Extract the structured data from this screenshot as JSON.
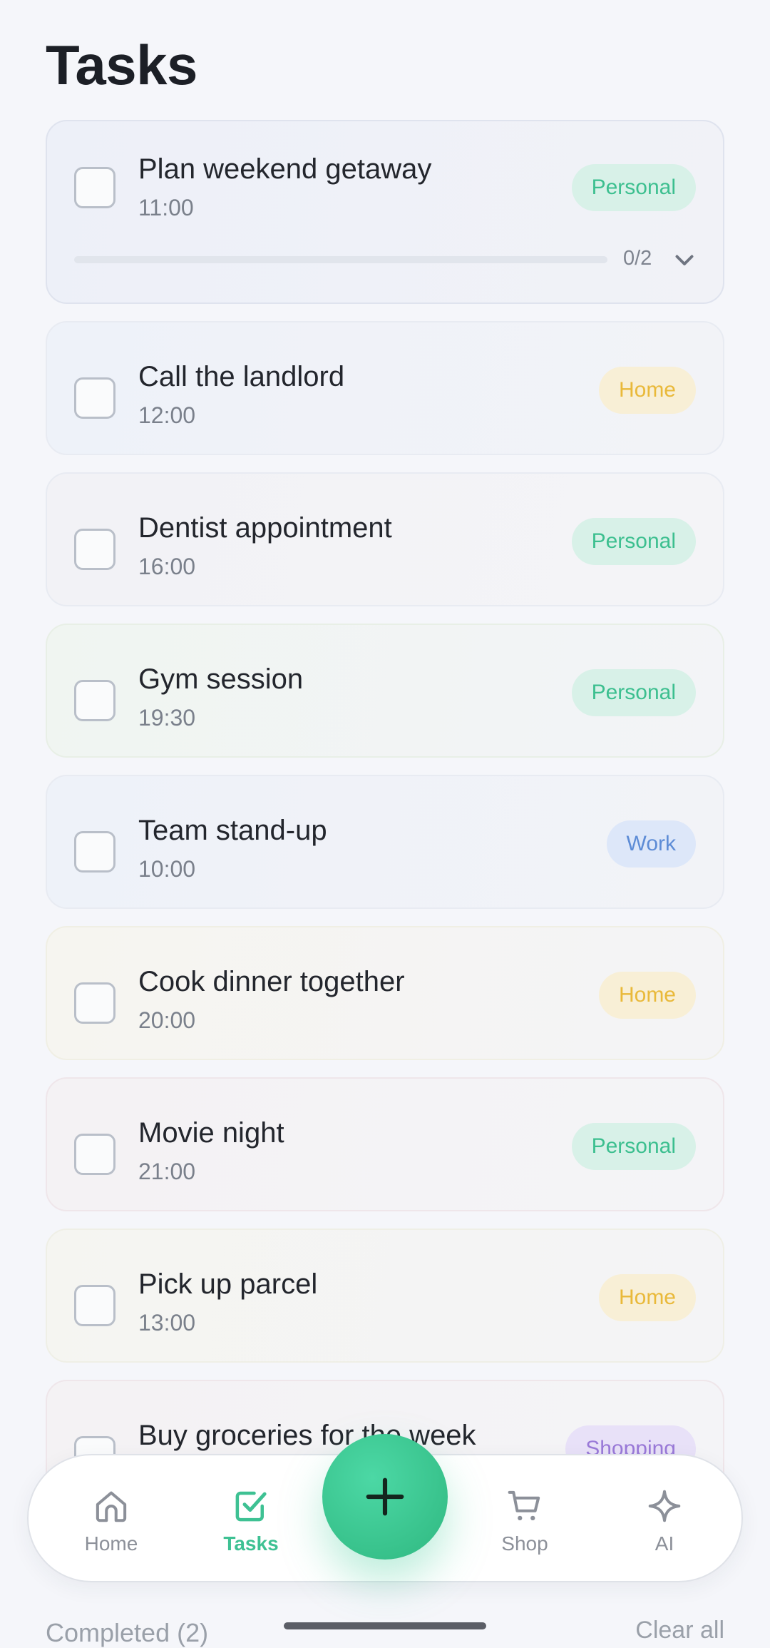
{
  "header": {
    "title": "Tasks"
  },
  "tasks": [
    {
      "title": "Plan weekend getaway",
      "time": "11:00",
      "tag": "Personal",
      "tag_type": "personal",
      "expanded": true,
      "subtasks_done": 0,
      "subtasks_total": 2,
      "progress_label": "0/2"
    },
    {
      "title": "Call the landlord",
      "time": "12:00",
      "tag": "Home",
      "tag_type": "home"
    },
    {
      "title": "Dentist appointment",
      "time": "16:00",
      "tag": "Personal",
      "tag_type": "personal"
    },
    {
      "title": "Gym session",
      "time": "19:30",
      "tag": "Personal",
      "tag_type": "personal"
    },
    {
      "title": "Team stand-up",
      "time": "10:00",
      "tag": "Work",
      "tag_type": "work"
    },
    {
      "title": "Cook dinner together",
      "time": "20:00",
      "tag": "Home",
      "tag_type": "home"
    },
    {
      "title": "Movie night",
      "time": "21:00",
      "tag": "Personal",
      "tag_type": "personal"
    },
    {
      "title": "Pick up parcel",
      "time": "13:00",
      "tag": "Home",
      "tag_type": "home"
    },
    {
      "title": "Buy groceries for the week",
      "time": "",
      "tag": "Shopping",
      "tag_type": "shopping"
    }
  ],
  "nav": {
    "items": [
      {
        "label": "Home",
        "icon": "home-icon",
        "active": false
      },
      {
        "label": "Tasks",
        "icon": "tasks-check-icon",
        "active": true
      },
      {
        "label": "Shop",
        "icon": "cart-icon",
        "active": false
      },
      {
        "label": "AI",
        "icon": "sparkle-icon",
        "active": false
      }
    ],
    "fab_icon": "plus-icon"
  },
  "footer": {
    "completed_label": "Completed (2)",
    "clear_all_label": "Clear all"
  },
  "colors": {
    "accent": "#3ecb97",
    "personal": "#3cbf8f",
    "home": "#e9b93a",
    "work": "#5d8cd6",
    "shopping": "#9a7ad8"
  }
}
